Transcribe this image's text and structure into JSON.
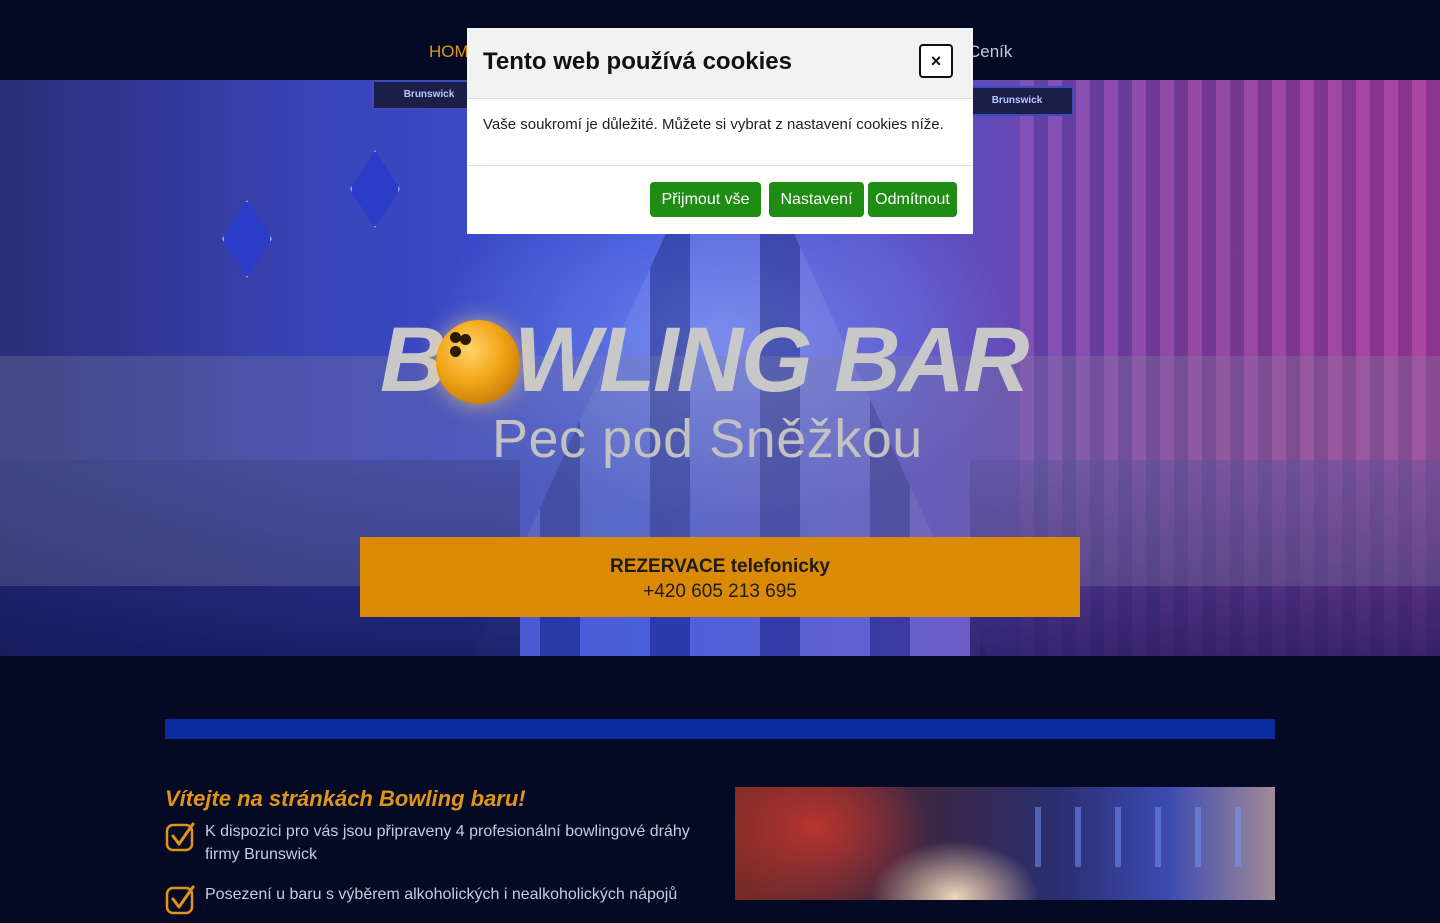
{
  "nav": {
    "items": [
      {
        "label": "HOM"
      },
      {
        "label": "Ceník"
      }
    ]
  },
  "hero": {
    "logo_title": "BOWLING BAR",
    "logo_subtitle": "Pec pod Sněžkou",
    "tv_label": "Brunswick",
    "reservation": {
      "title": "REZERVACE telefonicky",
      "phone": "+420 605 213 695"
    }
  },
  "welcome": {
    "title": "Vítejte na stránkách Bowling baru!",
    "features": [
      {
        "text": "K dispozici pro vás jsou připraveny 4 profesionální bowlingové dráhy firmy Brunswick"
      },
      {
        "text": "Posezení u baru s výběrem alkoholických i nealkoholických nápojů"
      }
    ]
  },
  "cookie_modal": {
    "title": "Tento web používá cookies",
    "close_label": "×",
    "message": "Vaše soukromí je důležité. Můžete si vybrat z nastavení cookies níže.",
    "buttons": {
      "accept": "Přijmout vše",
      "settings": "Nastavení",
      "reject": "Odmítnout"
    }
  },
  "colors": {
    "accent": "#db8a06",
    "background": "#040a24",
    "button_green": "#1f8c14",
    "bar_blue": "#0a2aa0"
  }
}
